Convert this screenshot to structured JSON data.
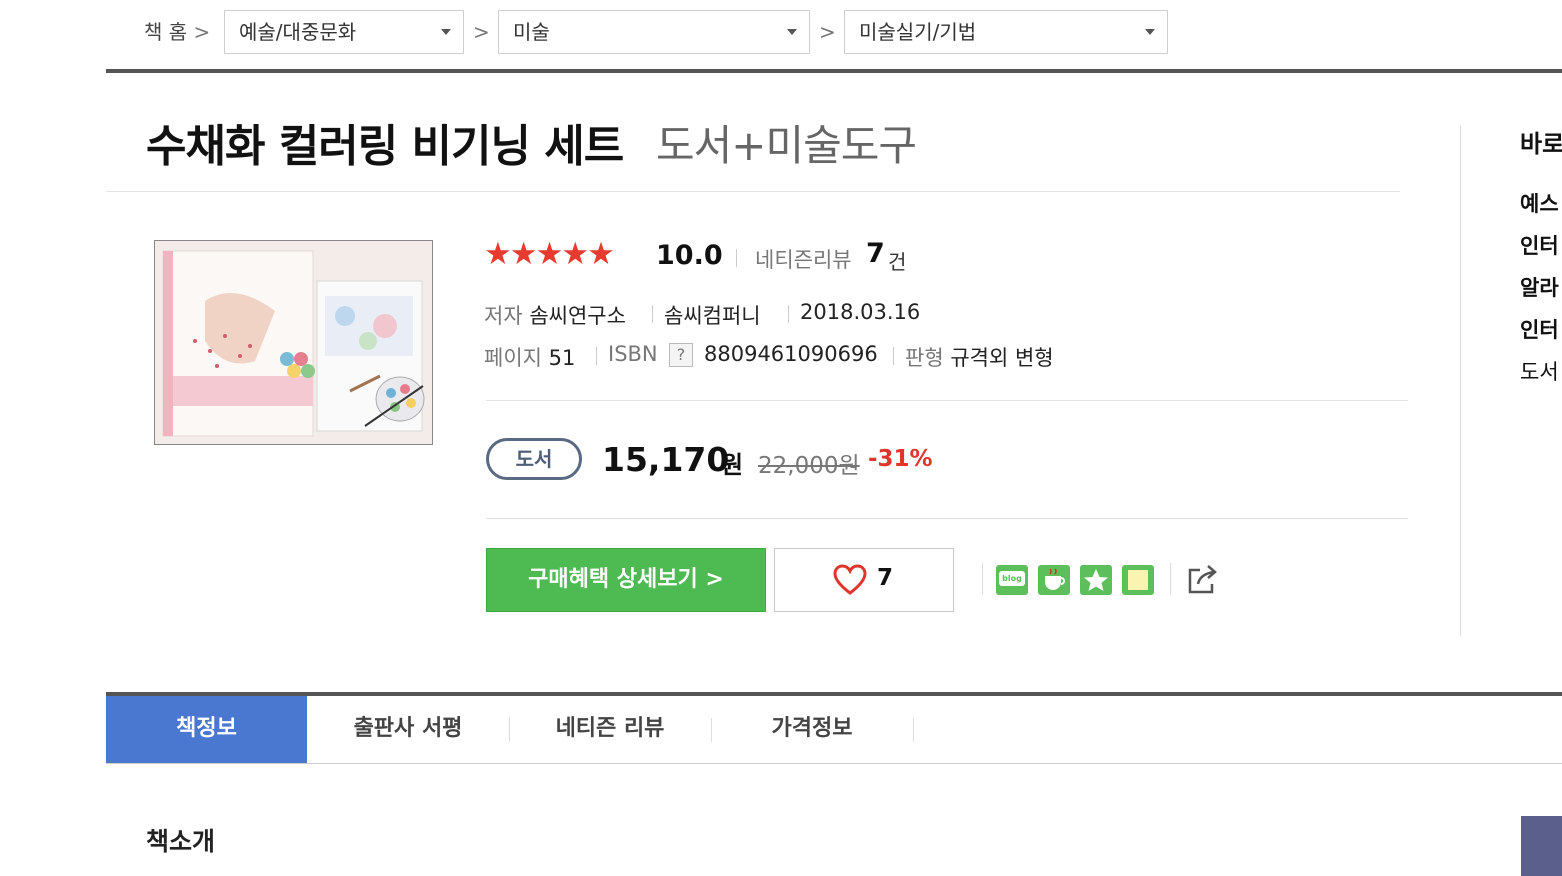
{
  "breadcrumb": {
    "home": "책 홈",
    "sep": ">",
    "level1": "예술/대중문화",
    "level2": "미술",
    "level3": "미술실기/기법"
  },
  "product": {
    "title": "수채화 컬러링 비기닝 세트",
    "subtitle": "도서+미술도구",
    "stars": "★★★★★",
    "rating": "10.0",
    "review_label": "네티즌리뷰",
    "review_count": "7",
    "review_unit": "건",
    "author_label": "저자",
    "author": "솜씨연구소",
    "publisher": "솜씨컴퍼니",
    "pub_date": "2018.03.16",
    "pages_label": "페이지",
    "pages": "51",
    "isbn_label": "ISBN",
    "isbn_help": "?",
    "isbn": "8809461090696",
    "format_label": "판형",
    "format": "규격외 변형",
    "badge": "도서",
    "price": "15,170",
    "price_unit": "원",
    "original_price": "22,000원",
    "discount": "-31%"
  },
  "actions": {
    "benefit_button": "구매혜택 상세보기 >",
    "like_count": "7",
    "sns_blog": "blog"
  },
  "right_panel": {
    "header": "바로",
    "items": [
      "예스",
      "인터",
      "알라",
      "인터",
      "도서"
    ]
  },
  "tabs": [
    "책정보",
    "출판사 서평",
    "네티즌 리뷰",
    "가격정보"
  ],
  "section_title": "책소개",
  "colors": {
    "accent_blue": "#4a78d0",
    "buy_green": "#4dba52",
    "star_red": "#e63c2f",
    "discount_red": "#e0352a"
  }
}
